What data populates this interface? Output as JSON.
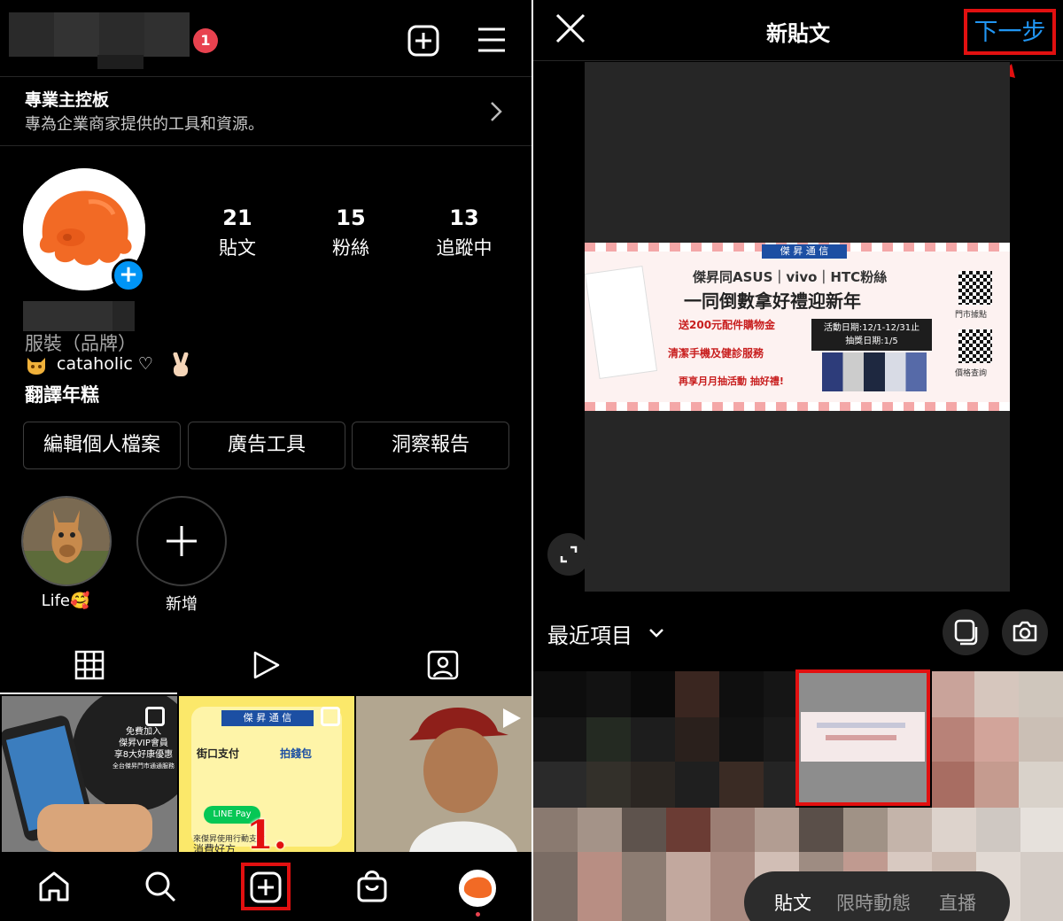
{
  "profile_screen": {
    "notification_count": "1",
    "dashboard": {
      "title": "專業主控板",
      "subtitle": "專為企業商家提供的工具和資源。"
    },
    "stats": [
      {
        "number": "21",
        "label": "貼文"
      },
      {
        "number": "15",
        "label": "粉絲"
      },
      {
        "number": "13",
        "label": "追蹤中"
      }
    ],
    "category": "服裝（品牌）",
    "bio_line1": "cataholic ♡",
    "bio_line2": "翻譯年糕",
    "buttons": [
      "編輯個人檔案",
      "廣告工具",
      "洞察報告"
    ],
    "highlights": [
      {
        "label": "Life🥰"
      },
      {
        "label": "新增"
      }
    ],
    "posts": [
      {
        "caption1": "免費加入",
        "caption2": "傑昇VIP會員",
        "caption3": "享8大好康優惠",
        "caption4": "全台傑昇門市通通服務"
      },
      {
        "brand": "傑 昇 通 信",
        "left": "街口支付",
        "right": "拍錢包",
        "pill": "LINE Pay",
        "bottom": "來傑昇使用行動支付",
        "bottom2": "消費好方"
      },
      {
        "desc": "baseball player"
      }
    ],
    "step_annotation": "1."
  },
  "new_post_screen": {
    "title": "新貼文",
    "next_label": "下一步",
    "banner": {
      "brand": "傑 昇 通 信",
      "headline1": "傑昇同ASUS｜vivo｜HTC粉絲",
      "headline2": "一同倒數拿好禮迎新年",
      "offer1": "送200元配件購物金",
      "offer2": "清潔手機及健診服務",
      "offer3": "再享月月抽活動 抽好禮!",
      "dates1": "活動日期:12/1-12/31止",
      "dates2": "抽獎日期:1/5",
      "qr1": "門市據點",
      "qr2": "價格查詢"
    },
    "album": "最近項目",
    "modes": [
      "貼文",
      "限時動態",
      "直播"
    ]
  },
  "colors": {
    "accent_blue": "#2196f3",
    "annotation_red": "#e21010",
    "badge_red": "#e8424f"
  }
}
